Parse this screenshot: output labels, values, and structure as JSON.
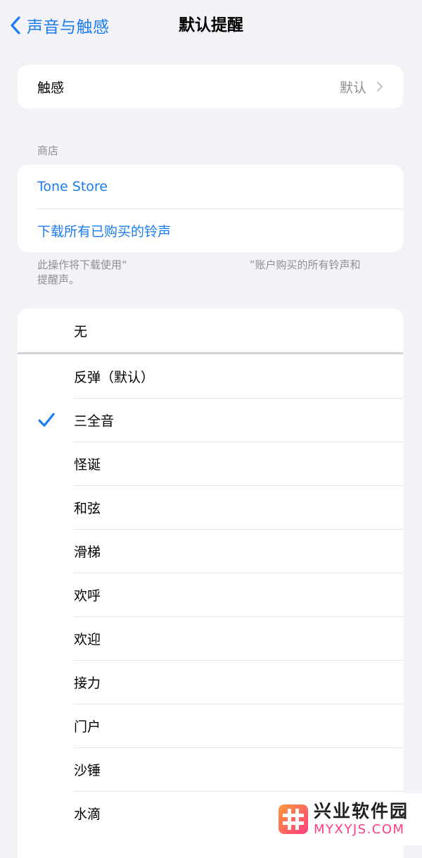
{
  "nav": {
    "back_label": "声音与触感",
    "title": "默认提醒"
  },
  "haptics": {
    "label": "触感",
    "value": "默认"
  },
  "store": {
    "header": "商店",
    "tone_store": "Tone Store",
    "download_all": "下载所有已购买的铃声",
    "footer_before": "此操作将下载使用“",
    "footer_after": "”账户购买的所有铃声和提醒声。"
  },
  "tones": {
    "none_label": "无",
    "items": [
      "反弹（默认）",
      "三全音",
      "怪诞",
      "和弦",
      "滑梯",
      "欢呼",
      "欢迎",
      "接力",
      "门户",
      "沙锤",
      "水滴"
    ],
    "selected": "三全音"
  },
  "watermark": {
    "title": "兴业软件园",
    "subtitle": "MYXYJS.COM"
  },
  "colors": {
    "accent": "#1a7cf0",
    "background": "#f2f2f7",
    "secondary_text": "#8e8e93"
  }
}
